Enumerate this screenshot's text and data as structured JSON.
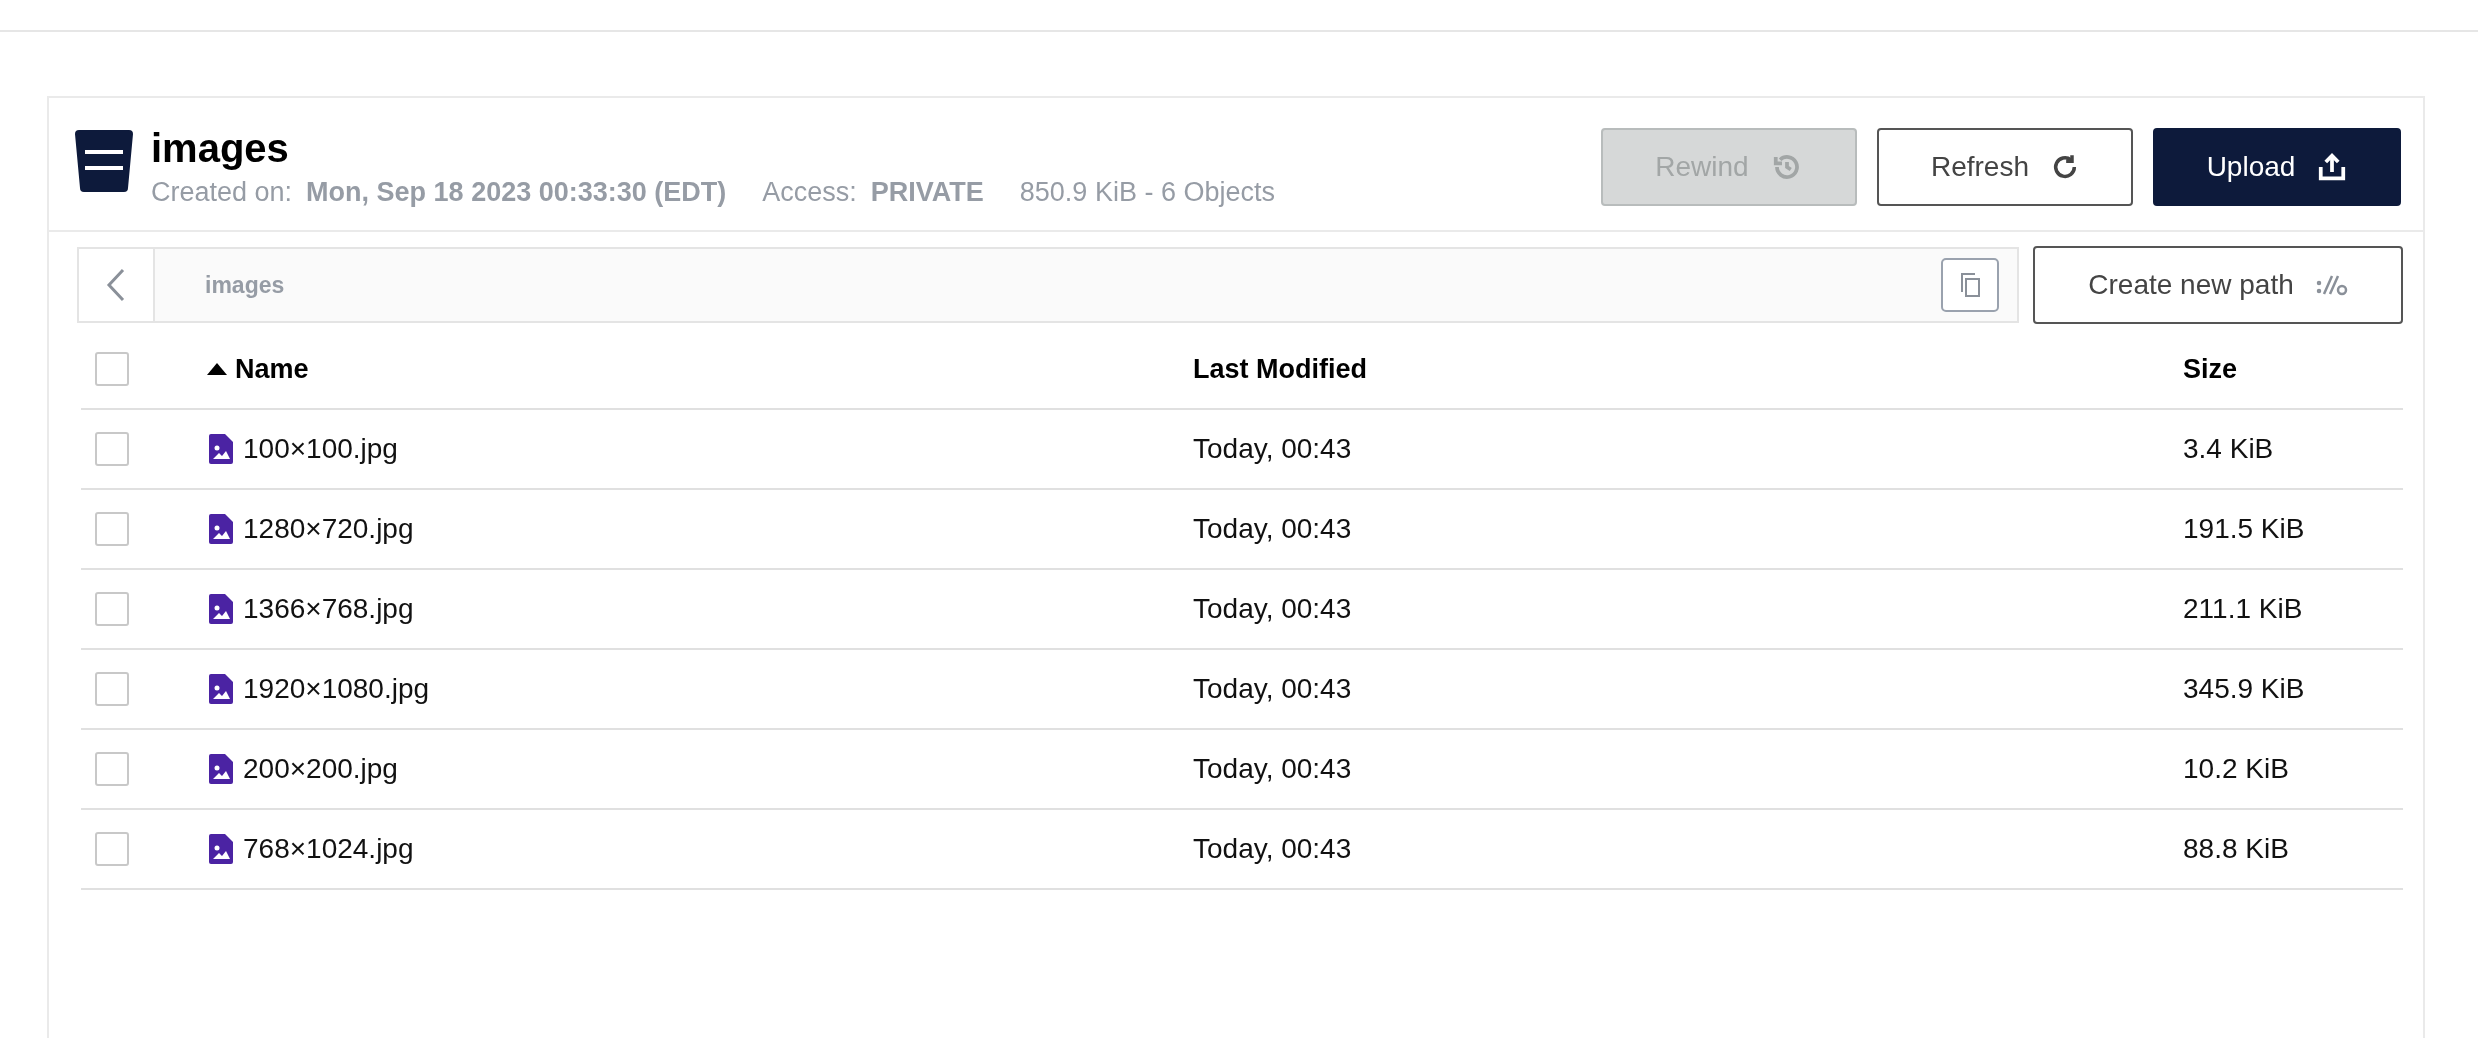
{
  "bucket": {
    "name": "images",
    "created_label": "Created on:",
    "created": "Mon, Sep 18 2023 00:33:30 (EDT)",
    "access_label": "Access:",
    "access": "PRIVATE",
    "usage": "850.9 KiB - 6 Objects"
  },
  "actions": [
    {
      "label": "Rewind",
      "kind": "rewind",
      "disabled": true
    },
    {
      "label": "Refresh",
      "kind": "refresh",
      "disabled": false
    },
    {
      "label": "Upload",
      "kind": "upload",
      "disabled": false
    }
  ],
  "path": {
    "value": "images",
    "create_label": "Create new path"
  },
  "table": {
    "all_checked": false,
    "columns": [
      {
        "label": "Name",
        "sorted": true
      },
      {
        "label": "Last Modified",
        "sorted": false
      },
      {
        "label": "Size",
        "sorted": false
      }
    ],
    "rows": [
      {
        "name": "100×100.jpg",
        "modified": "Today, 00:43",
        "size": "3.4 KiB",
        "checked": false
      },
      {
        "name": "1280×720.jpg",
        "modified": "Today, 00:43",
        "size": "191.5 KiB",
        "checked": false
      },
      {
        "name": "1366×768.jpg",
        "modified": "Today, 00:43",
        "size": "211.1 KiB",
        "checked": false
      },
      {
        "name": "1920×1080.jpg",
        "modified": "Today, 00:43",
        "size": "345.9 KiB",
        "checked": false
      },
      {
        "name": "200×200.jpg",
        "modified": "Today, 00:43",
        "size": "10.2 KiB",
        "checked": false
      },
      {
        "name": "768×1024.jpg",
        "modified": "Today, 00:43",
        "size": "88.8 KiB",
        "checked": false
      }
    ]
  }
}
